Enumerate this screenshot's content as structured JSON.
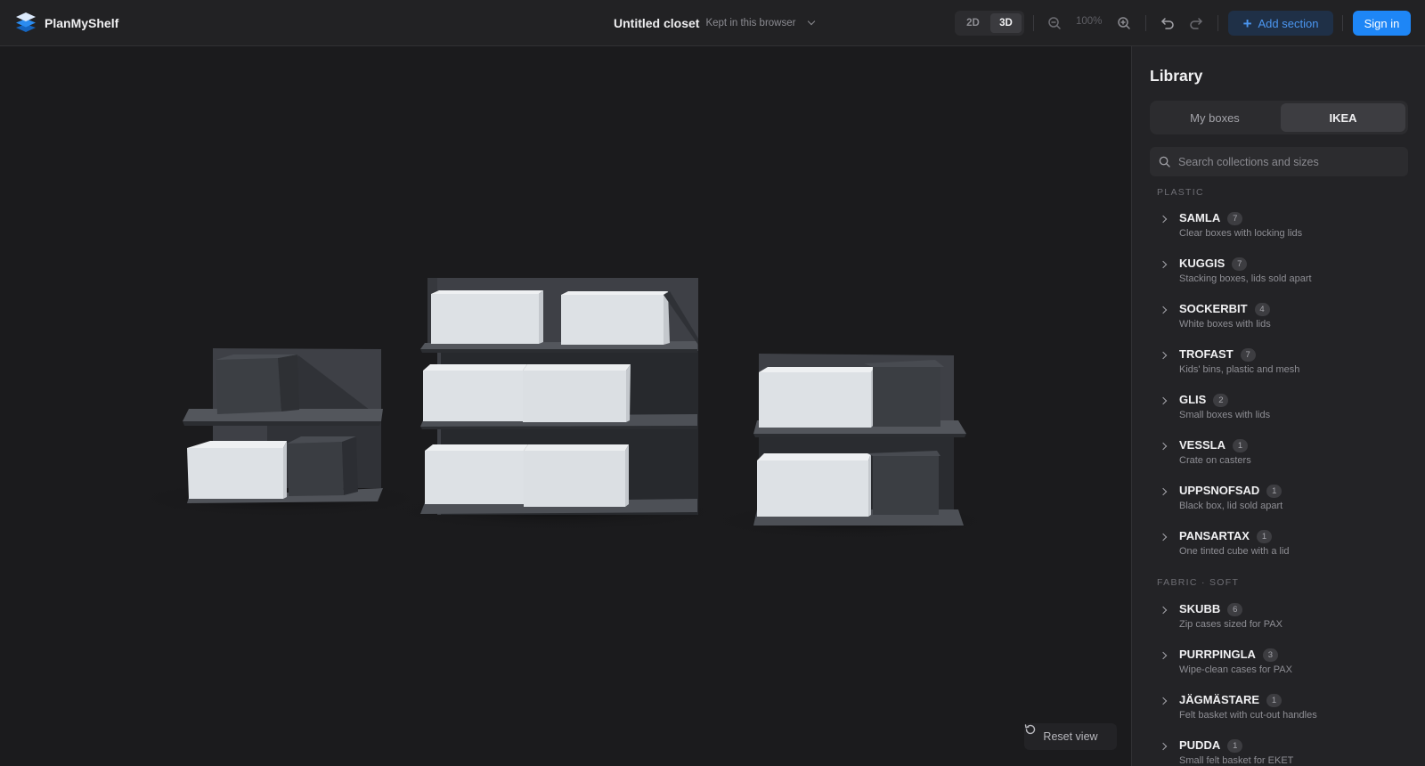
{
  "app": {
    "name": "PlanMyShelf",
    "doc_title": "Untitled closet",
    "doc_status": "Kept in this browser"
  },
  "toolbar": {
    "view_modes": [
      "2D",
      "3D"
    ],
    "active_view": "3D",
    "zoom": "100%",
    "add_section": "Add section",
    "sign_in": "Sign in"
  },
  "canvas": {
    "reset_view": "Reset view"
  },
  "library": {
    "title": "Library",
    "tabs": [
      "My boxes",
      "IKEA"
    ],
    "active_tab": "IKEA",
    "search_placeholder": "Search collections and sizes",
    "groups": [
      {
        "label": "PLASTIC",
        "items": [
          {
            "name": "SAMLA",
            "count": "7",
            "desc": "Clear boxes with locking lids"
          },
          {
            "name": "KUGGIS",
            "count": "7",
            "desc": "Stacking boxes, lids sold apart"
          },
          {
            "name": "SOCKERBIT",
            "count": "4",
            "desc": "White boxes with lids"
          },
          {
            "name": "TROFAST",
            "count": "7",
            "desc": "Kids' bins, plastic and mesh"
          },
          {
            "name": "GLIS",
            "count": "2",
            "desc": "Small boxes with lids"
          },
          {
            "name": "VESSLA",
            "count": "1",
            "desc": "Crate on casters"
          },
          {
            "name": "UPPSNOFSAD",
            "count": "1",
            "desc": "Black box, lid sold apart"
          },
          {
            "name": "PANSARTAX",
            "count": "1",
            "desc": "One tinted cube with a lid"
          }
        ]
      },
      {
        "label": "FABRIC · SOFT",
        "items": [
          {
            "name": "SKUBB",
            "count": "6",
            "desc": "Zip cases sized for PAX"
          },
          {
            "name": "PURRPINGLA",
            "count": "3",
            "desc": "Wipe-clean cases for PAX"
          },
          {
            "name": "JÄGMÄSTARE",
            "count": "1",
            "desc": "Felt basket with cut-out handles"
          },
          {
            "name": "PUDDA",
            "count": "1",
            "desc": "Small felt basket for EKET"
          }
        ]
      }
    ]
  },
  "colors": {
    "accent": "#1e86f6",
    "background": "#1b1b1d",
    "panel": "#232326",
    "box_white": "#dde1e5",
    "box_dark": "#3b3e43"
  }
}
